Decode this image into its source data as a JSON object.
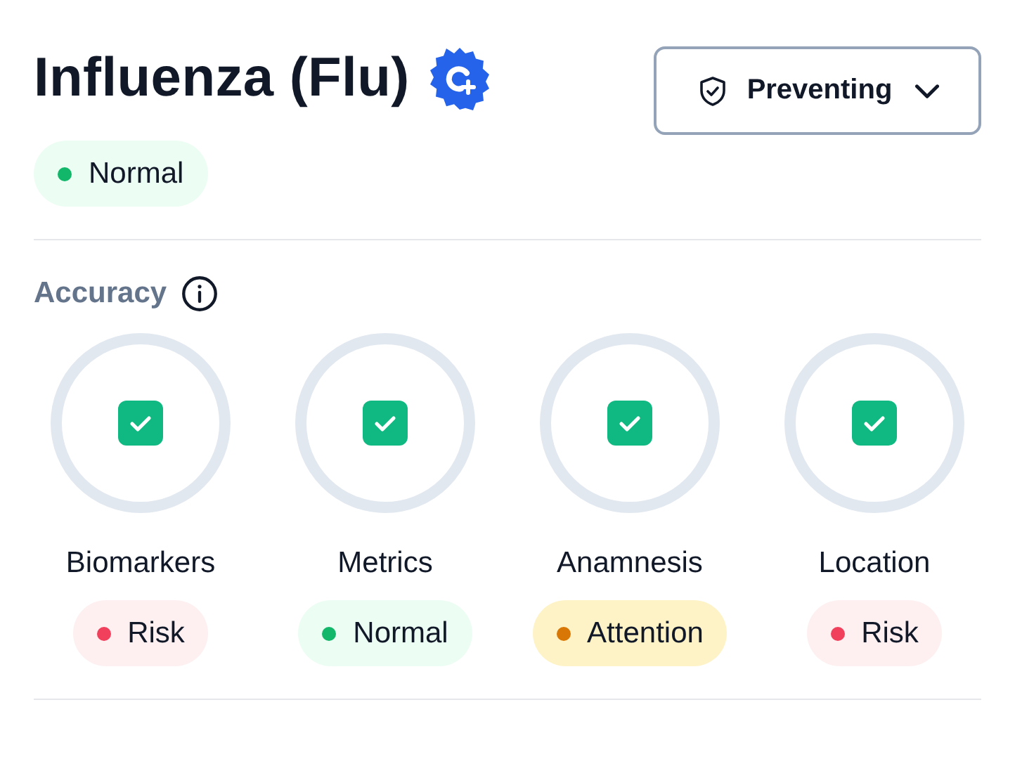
{
  "header": {
    "title": "Influenza (Flu)",
    "status": {
      "label": "Normal",
      "kind": "normal"
    }
  },
  "dropdown": {
    "label": "Preventing"
  },
  "accuracy": {
    "label": "Accuracy"
  },
  "metrics": [
    {
      "name": "Biomarkers",
      "checked": true,
      "status": {
        "label": "Risk",
        "kind": "risk"
      }
    },
    {
      "name": "Metrics",
      "checked": true,
      "status": {
        "label": "Normal",
        "kind": "normal"
      }
    },
    {
      "name": "Anamnesis",
      "checked": true,
      "status": {
        "label": "Attention",
        "kind": "attention"
      }
    },
    {
      "name": "Location",
      "checked": true,
      "status": {
        "label": "Risk",
        "kind": "risk"
      }
    }
  ]
}
